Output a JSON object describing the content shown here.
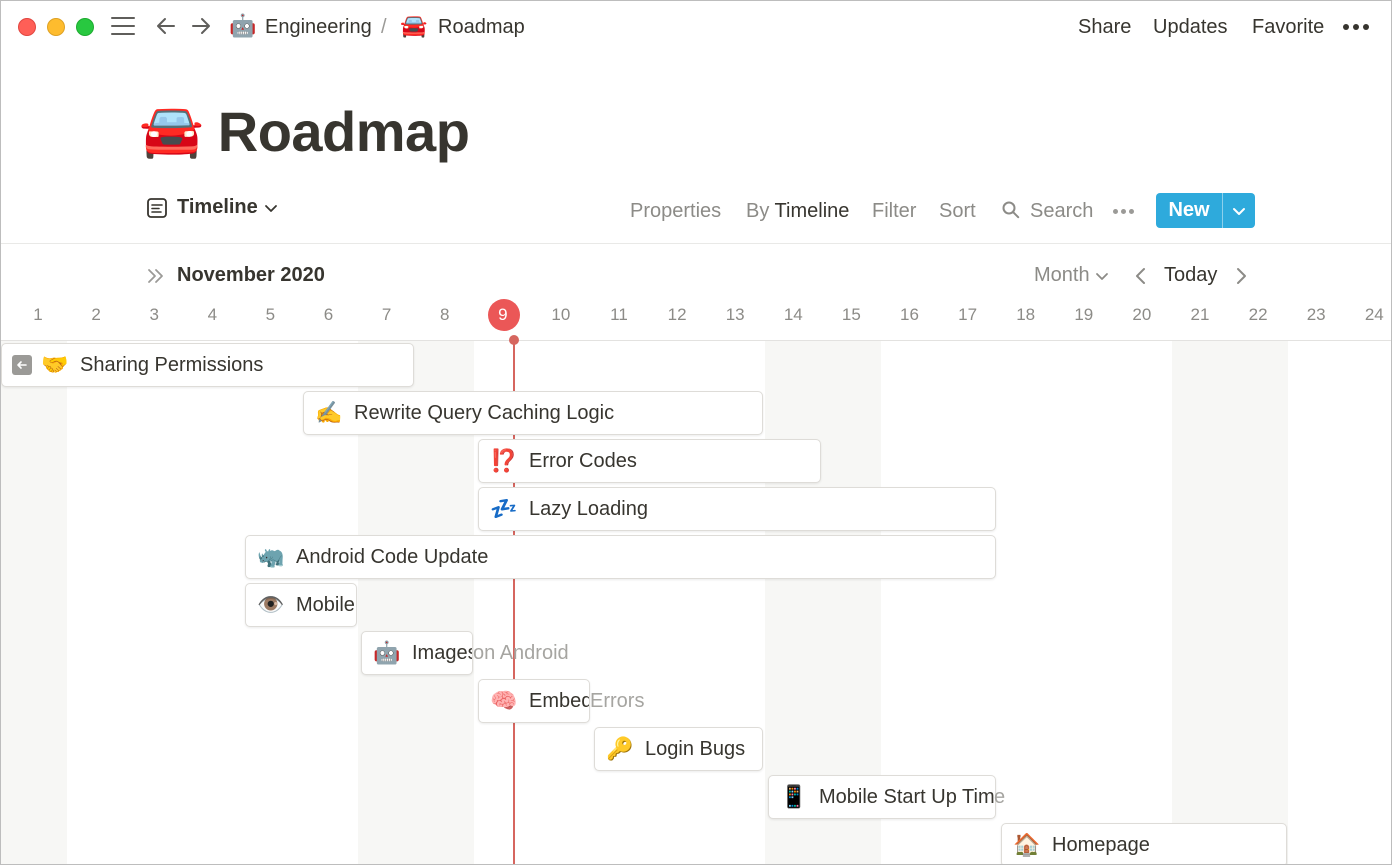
{
  "breadcrumb": {
    "items": [
      {
        "icon": "🤖",
        "label": "Engineering"
      },
      {
        "icon": "🚘",
        "label": "Roadmap"
      }
    ],
    "separator": "/"
  },
  "topbar": {
    "share": "Share",
    "updates": "Updates",
    "favorite": "Favorite"
  },
  "page": {
    "icon": "🚘",
    "title": "Roadmap"
  },
  "view": {
    "name": "Timeline",
    "properties": "Properties",
    "by_prefix": "By",
    "by_value": "Timeline",
    "filter": "Filter",
    "sort": "Sort",
    "search": "Search",
    "new_label": "New"
  },
  "timeline": {
    "month": "November 2020",
    "scale": "Month",
    "today_label": "Today",
    "today_day": 9,
    "days": [
      1,
      2,
      3,
      4,
      5,
      6,
      7,
      8,
      9,
      10,
      11,
      12,
      13,
      14,
      15,
      16,
      17,
      18,
      19,
      20,
      21,
      22,
      23,
      24
    ],
    "colors": {
      "today": "#eb5757",
      "accent": "#2eaadc"
    }
  },
  "tasks": [
    {
      "icon": "🤝",
      "label": "Sharing Permissions",
      "overflow": ""
    },
    {
      "icon": "✍️",
      "label": "Rewrite Query Caching Logic",
      "overflow": ""
    },
    {
      "icon": "⁉️",
      "label": "Error Codes",
      "overflow": ""
    },
    {
      "icon": "💤",
      "label": "Lazy Loading",
      "overflow": ""
    },
    {
      "icon": "🦏",
      "label": "Android Code Update",
      "overflow": ""
    },
    {
      "icon": "👁️",
      "label": "Mobile",
      "overflow": ""
    },
    {
      "icon": "🤖",
      "label": "Images",
      "overflow": " on Android"
    },
    {
      "icon": "🧠",
      "label": "Embed",
      "overflow": " Errors"
    },
    {
      "icon": "🔑",
      "label": "Login Bugs",
      "overflow": ""
    },
    {
      "icon": "📱",
      "label": "Mobile Start Up Tim",
      "overflow": "e"
    },
    {
      "icon": "🏠",
      "label": "Homepage",
      "overflow": ""
    }
  ]
}
